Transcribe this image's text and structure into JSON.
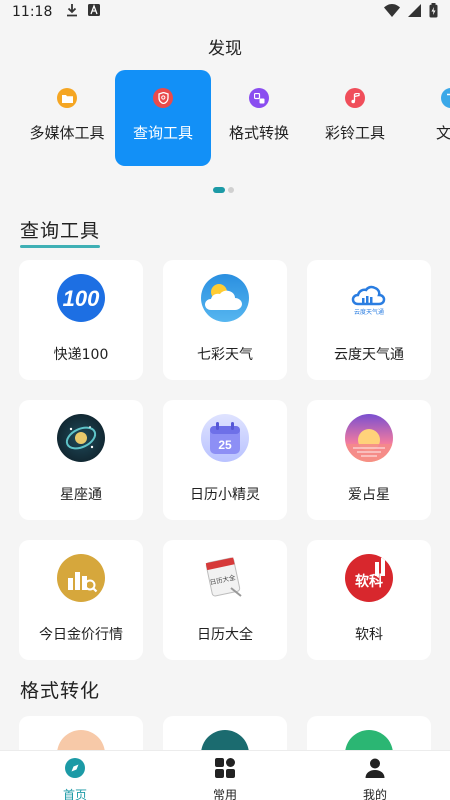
{
  "status": {
    "time": "11:18"
  },
  "header": {
    "title": "发现"
  },
  "categories": [
    {
      "label": "多媒体工具",
      "color": "#f5a623",
      "active": false
    },
    {
      "label": "查询工具",
      "color": "#e94b4b",
      "active": true
    },
    {
      "label": "格式转换",
      "color": "#8a4df0",
      "active": false
    },
    {
      "label": "彩铃工具",
      "color": "#f04e5a",
      "active": false
    },
    {
      "label": "文字",
      "color": "#3aa8e8",
      "active": false
    }
  ],
  "sections": [
    {
      "title": "查询工具",
      "items": [
        {
          "name": "快递100",
          "icon": "kuaidi100-icon"
        },
        {
          "name": "七彩天气",
          "icon": "weather-sun-cloud-icon"
        },
        {
          "name": "云度天气通",
          "icon": "cloud-weather-icon",
          "logo_text": "云度天气通"
        },
        {
          "name": "星座通",
          "icon": "galaxy-icon"
        },
        {
          "name": "日历小精灵",
          "icon": "calendar-icon",
          "badge": "25"
        },
        {
          "name": "爱占星",
          "icon": "sunset-icon"
        },
        {
          "name": "今日金价行情",
          "icon": "gold-chart-icon"
        },
        {
          "name": "日历大全",
          "icon": "tear-calendar-icon",
          "logo_text": "日历大全"
        },
        {
          "name": "软科",
          "icon": "ruanke-icon",
          "logo_text": "软科"
        }
      ]
    },
    {
      "title": "格式转化",
      "items": [
        {
          "name": "",
          "icon": "orange-app-icon"
        },
        {
          "name": "",
          "icon": "teal-app-icon"
        },
        {
          "name": "",
          "icon": "green-app-icon"
        }
      ]
    }
  ],
  "tabs": [
    {
      "label": "首页",
      "icon": "compass-icon",
      "active": true
    },
    {
      "label": "常用",
      "icon": "grid-icon",
      "active": false
    },
    {
      "label": "我的",
      "icon": "user-icon",
      "active": false
    }
  ],
  "colors": {
    "accent": "#1290f7",
    "teal": "#1c9aa6"
  }
}
